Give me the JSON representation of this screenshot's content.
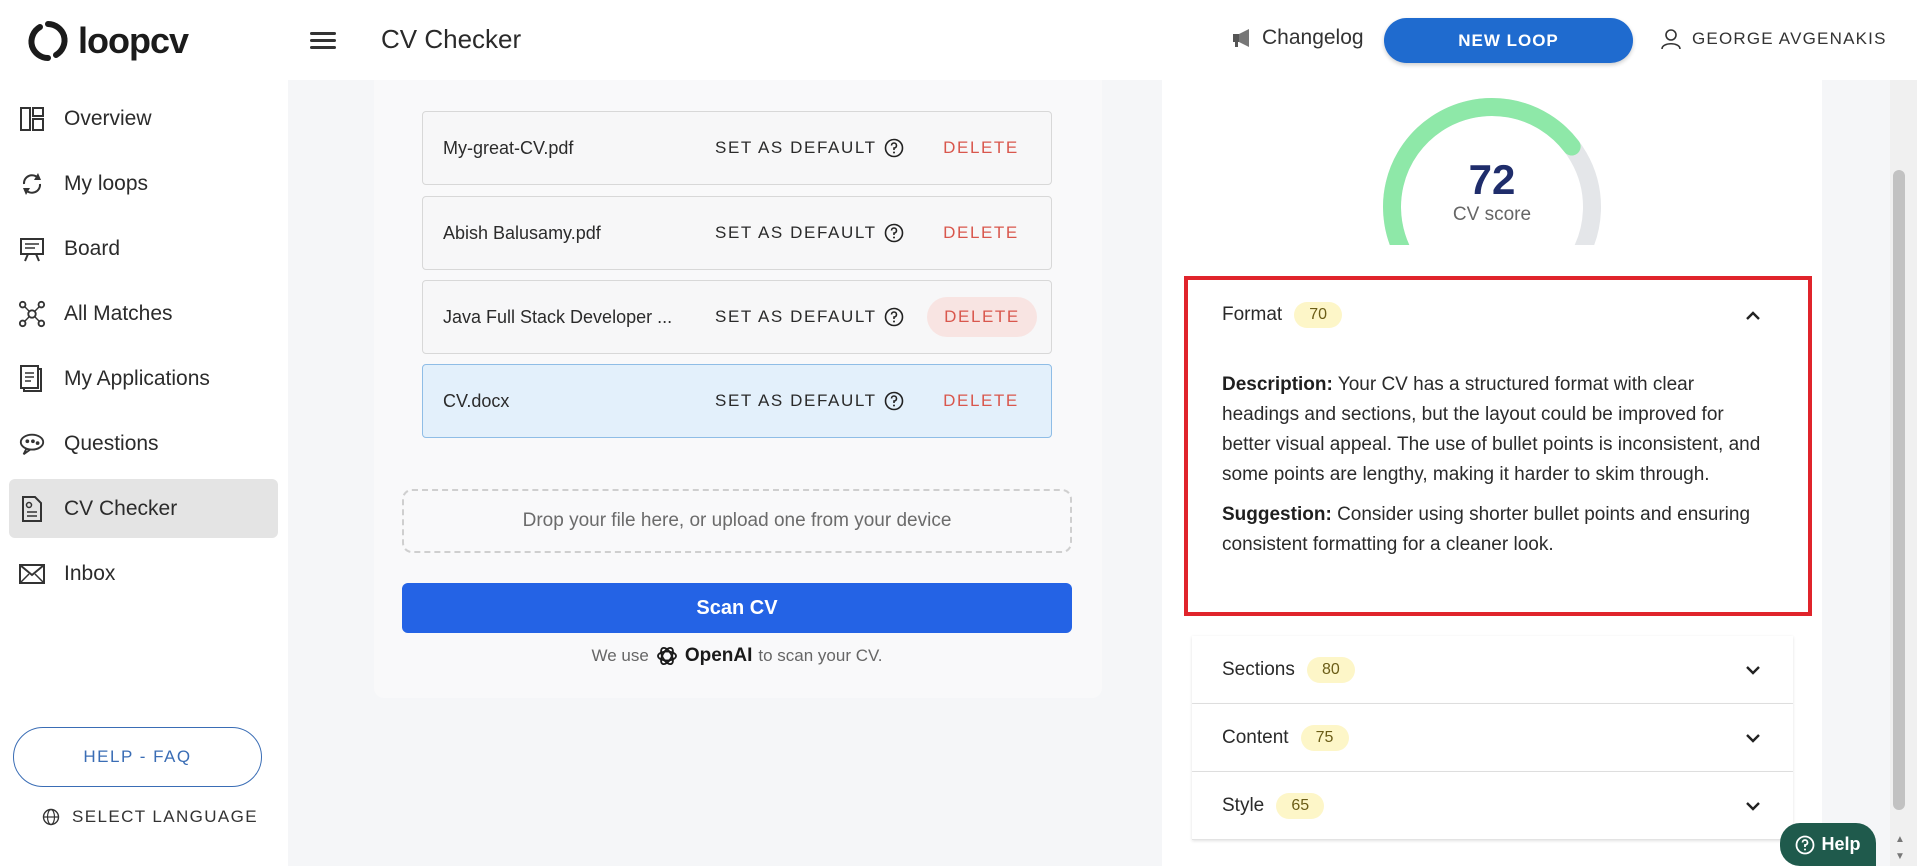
{
  "brand": {
    "name": "loopcv"
  },
  "header": {
    "title": "CV Checker",
    "changelog_label": "Changelog",
    "new_loop_label": "NEW LOOP",
    "user_name": "GEORGE AVGENAKIS"
  },
  "sidebar": {
    "items": [
      {
        "label": "Overview",
        "icon": "dashboard-icon"
      },
      {
        "label": "My loops",
        "icon": "loop-icon"
      },
      {
        "label": "Board",
        "icon": "board-icon"
      },
      {
        "label": "All Matches",
        "icon": "matches-icon"
      },
      {
        "label": "My Applications",
        "icon": "applications-icon"
      },
      {
        "label": "Questions",
        "icon": "questions-icon"
      },
      {
        "label": "CV Checker",
        "icon": "cv-checker-icon",
        "active": true
      },
      {
        "label": "Inbox",
        "icon": "inbox-icon"
      }
    ],
    "help_faq_label": "HELP - FAQ",
    "select_language_label": "SELECT LANGUAGE"
  },
  "files": [
    {
      "name": "My-great-CV.pdf",
      "set_default_label": "SET AS DEFAULT",
      "delete_label": "DELETE"
    },
    {
      "name": "Abish Balusamy.pdf",
      "set_default_label": "SET AS DEFAULT",
      "delete_label": "DELETE"
    },
    {
      "name": "Java Full Stack Developer ...",
      "set_default_label": "SET AS DEFAULT",
      "delete_label": "DELETE"
    },
    {
      "name": "CV.docx",
      "set_default_label": "SET AS DEFAULT",
      "delete_label": "DELETE",
      "selected": true
    }
  ],
  "upload": {
    "dropzone_text": "Drop your file here, or upload one from your device",
    "scan_button_label": "Scan CV",
    "note_prefix": "We use",
    "note_brand": "OpenAI",
    "note_suffix": "to scan your CV."
  },
  "score": {
    "value": "72",
    "label": "CV score",
    "fraction": 0.72,
    "colors": {
      "fill": "#8ee8a8",
      "track": "#e4e6e9"
    }
  },
  "sections": [
    {
      "title": "Format",
      "score": "70",
      "expanded": true,
      "description_label": "Description:",
      "description": "Your CV has a structured format with clear headings and sections, but the layout could be improved for better visual appeal. The use of bullet points is inconsistent, and some points are lengthy, making it harder to skim through.",
      "suggestion_label": "Suggestion:",
      "suggestion": "Consider using shorter bullet points and ensuring consistent formatting for a cleaner look."
    },
    {
      "title": "Sections",
      "score": "80",
      "expanded": false
    },
    {
      "title": "Content",
      "score": "75",
      "expanded": false
    },
    {
      "title": "Style",
      "score": "65",
      "expanded": false
    }
  ],
  "help_widget": {
    "label": "Help"
  },
  "colors": {
    "accent": "#1f6bcf",
    "scan_button": "#2463e5",
    "delete": "#d9574d",
    "badge_bg": "#fdf6c8",
    "highlight_border": "#e0242b"
  }
}
